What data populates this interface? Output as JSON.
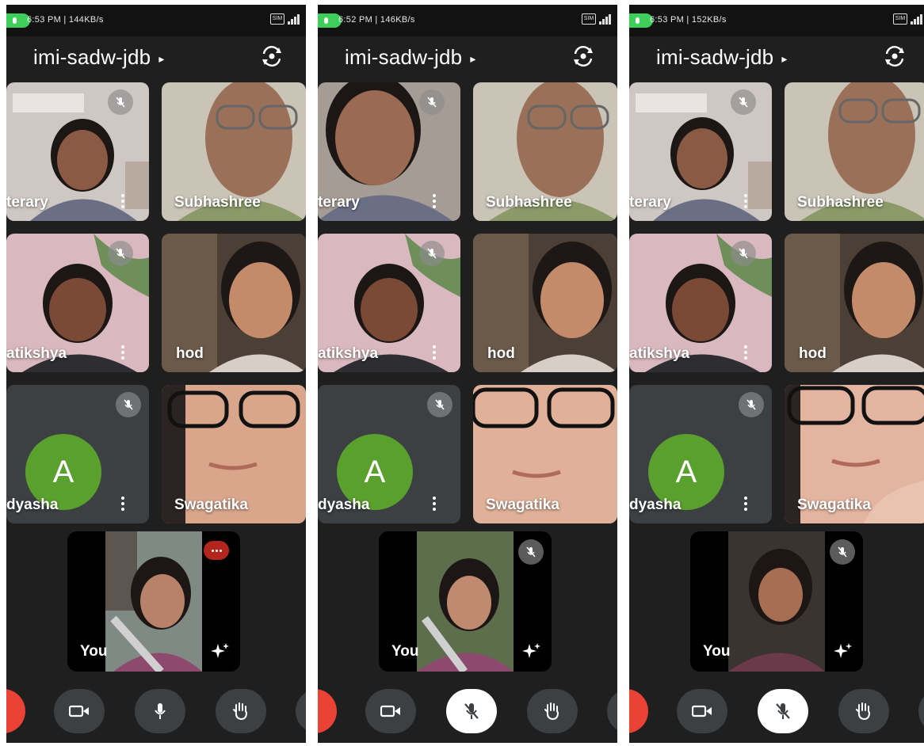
{
  "colors": {
    "background": "#1f1f1f",
    "tile": "#3c4043",
    "avatar": "#5aa02c",
    "end_call": "#ea4335",
    "status_dot": "#3ecf5a"
  },
  "screens": [
    {
      "status": {
        "time_speed": "6:53 PM | 144KB/s",
        "sim_label": "SIM"
      },
      "meeting_code": "imi-sadw-jdb",
      "participants": [
        "terary",
        "Subhashree",
        "atikshya",
        "hod",
        "dyasha",
        "Swagatika"
      ],
      "avatar_letter": "A",
      "self_label": "You",
      "self_indicator": "speaking",
      "mic_state": "unmuted"
    },
    {
      "status": {
        "time_speed": "6:52 PM | 146KB/s",
        "sim_label": "SIM"
      },
      "meeting_code": "imi-sadw-jdb",
      "participants": [
        "terary",
        "Subhashree",
        "atikshya",
        "hod",
        "dyasha",
        "Swagatika"
      ],
      "avatar_letter": "A",
      "self_label": "You",
      "self_indicator": "muted",
      "mic_state": "muted"
    },
    {
      "status": {
        "time_speed": "6:53 PM | 152KB/s",
        "sim_label": "SIM"
      },
      "meeting_code": "imi-sadw-jdb",
      "participants": [
        "terary",
        "Subhashree",
        "atikshya",
        "hod",
        "dyasha",
        "Swagatika"
      ],
      "avatar_letter": "A",
      "self_label": "You",
      "self_indicator": "muted",
      "mic_state": "muted"
    }
  ]
}
